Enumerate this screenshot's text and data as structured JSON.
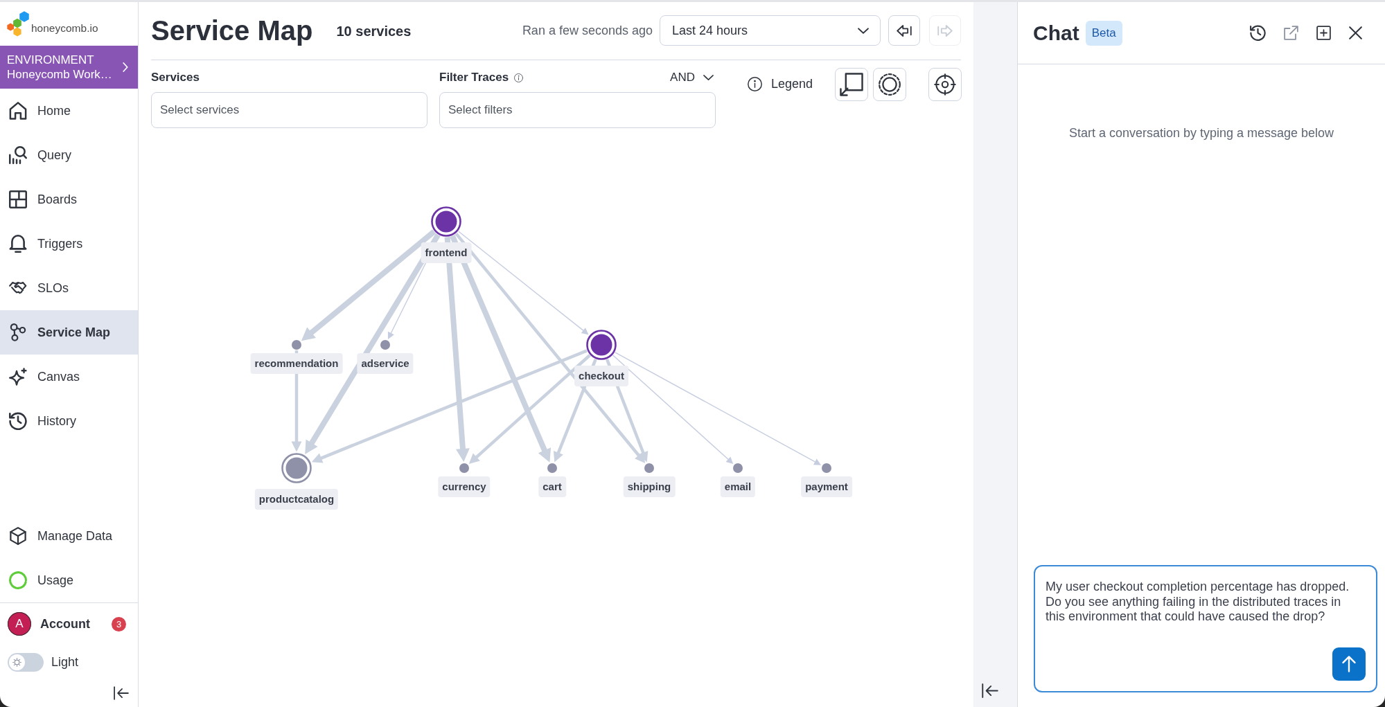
{
  "sidebar": {
    "logo": "honeycomb.io",
    "environment": {
      "label": "ENVIRONMENT",
      "name": "Honeycomb Work…"
    },
    "items": [
      {
        "label": "Home",
        "selected": false
      },
      {
        "label": "Query",
        "selected": false
      },
      {
        "label": "Boards",
        "selected": false
      },
      {
        "label": "Triggers",
        "selected": false
      },
      {
        "label": "SLOs",
        "selected": false
      },
      {
        "label": "Service Map",
        "selected": true
      },
      {
        "label": "Canvas",
        "selected": false
      },
      {
        "label": "History",
        "selected": false
      }
    ],
    "bottom_items": [
      {
        "label": "Manage Data",
        "selected": false
      },
      {
        "label": "Usage",
        "selected": false
      }
    ],
    "account": {
      "initial": "A",
      "label": "Account",
      "badge": "3"
    },
    "theme_toggle": {
      "label": "Light",
      "on": false
    }
  },
  "header": {
    "title": "Service Map",
    "count": "10 services",
    "status": "Ran a few seconds ago",
    "time_range": "Last 24 hours",
    "back_button": {
      "disabled": false
    },
    "forward_button": {
      "disabled": true
    }
  },
  "filters": {
    "services": {
      "label": "Services",
      "placeholder": "Select services"
    },
    "filter_traces": {
      "label": "Filter Traces",
      "operator": "AND",
      "placeholder": "Select filters"
    },
    "legend": "Legend"
  },
  "service_map": {
    "services": [
      {
        "name": "frontend",
        "kind": "ring",
        "color": "#6b33a6",
        "calls": {
          "recommendation": {
            "kind": "heavy"
          },
          "adservice": {
            "kind": "light"
          },
          "productcatalog": {
            "kind": "heavy"
          },
          "currency": {
            "kind": "heavy"
          },
          "cart": {
            "kind": "heavy"
          },
          "shipping": {
            "kind": "medium"
          },
          "checkout": {
            "kind": "light"
          }
        }
      },
      {
        "name": "recommendation",
        "kind": "dot",
        "color": "#8e91a8",
        "calls": {
          "productcatalog": {
            "kind": "medium"
          }
        }
      },
      {
        "name": "adservice",
        "kind": "dot",
        "color": "#8e91a8"
      },
      {
        "name": "checkout",
        "kind": "ring",
        "color": "#6b33a6",
        "calls": {
          "productcatalog": {
            "kind": "medium"
          },
          "currency": {
            "kind": "medium"
          },
          "cart": {
            "kind": "medium"
          },
          "shipping": {
            "kind": "medium"
          },
          "email": {
            "kind": "light"
          },
          "payment": {
            "kind": "light"
          }
        }
      },
      {
        "name": "productcatalog",
        "kind": "ring",
        "color": "#8e91a8"
      },
      {
        "name": "currency",
        "kind": "dot",
        "color": "#8e91a8"
      },
      {
        "name": "cart",
        "kind": "dot",
        "color": "#8e91a8"
      },
      {
        "name": "shipping",
        "kind": "dot",
        "color": "#8e91a8"
      },
      {
        "name": "email",
        "kind": "dot",
        "color": "#8e91a8"
      },
      {
        "name": "payment",
        "kind": "dot",
        "color": "#8e91a8"
      }
    ]
  },
  "chat": {
    "title": "Chat",
    "badge": "Beta",
    "empty_message": "Start a conversation by typing a message below",
    "input": {
      "value": "My user checkout completion percentage has dropped. Do you see anything failing in the distributed traces in this environment that could have caused the drop?",
      "focused": true
    }
  }
}
